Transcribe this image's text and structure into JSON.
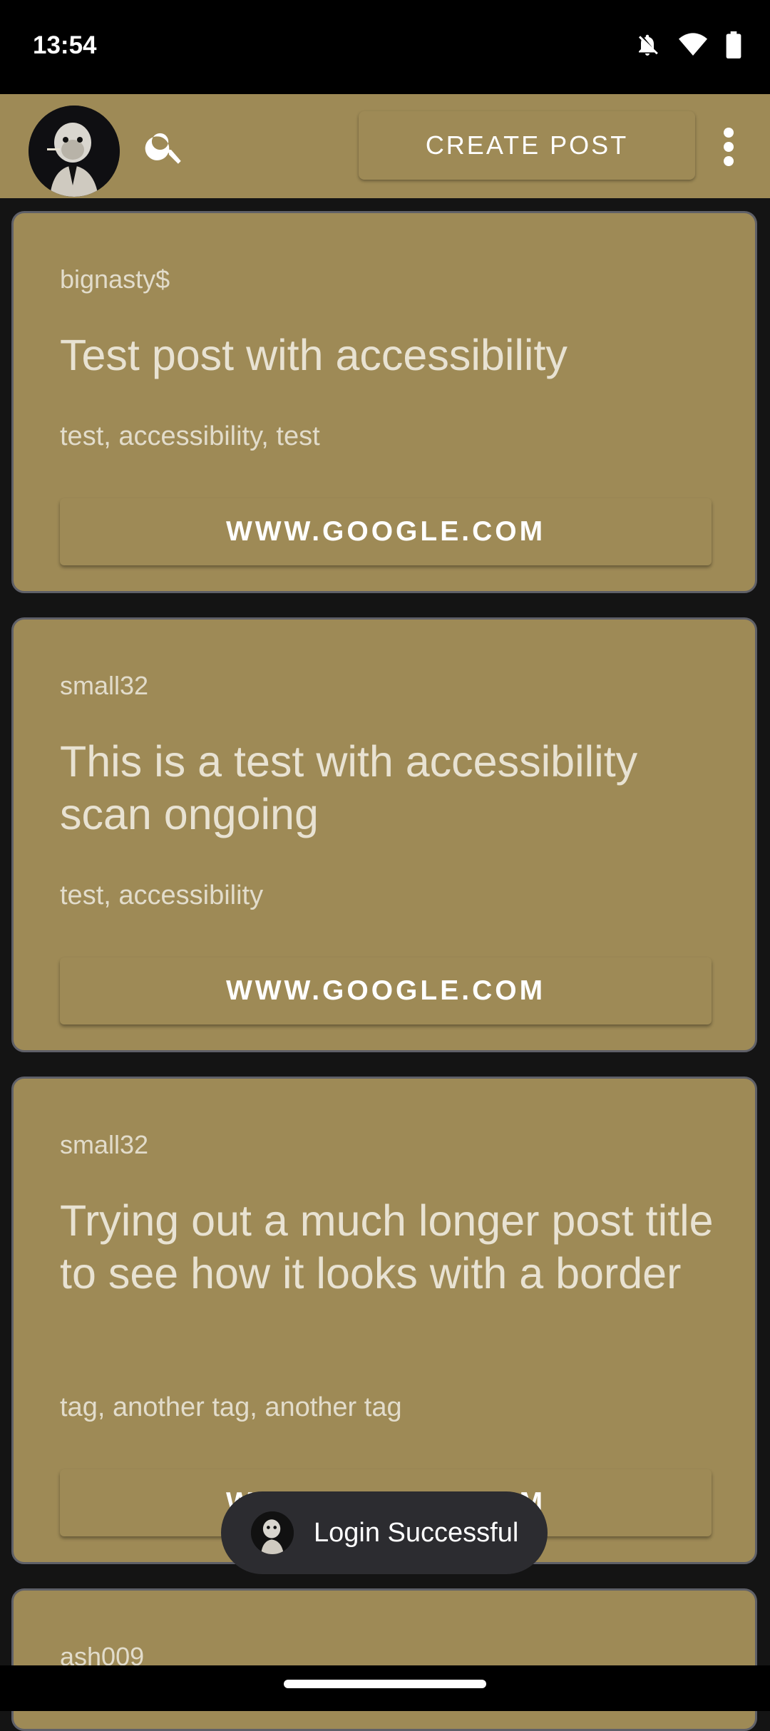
{
  "status_bar": {
    "time": "13:54",
    "icons": [
      "bell-off-icon",
      "wifi-icon",
      "battery-icon"
    ]
  },
  "app_bar": {
    "avatar_icon": "monkey-avatar",
    "search_icon": "search-icon",
    "create_post_label": "CREATE POST",
    "more_icon": "more-vert-icon",
    "color": "#9e8a56"
  },
  "posts": [
    {
      "user": "bignasty$",
      "title": "Test post with accessibility",
      "tags": "test, accessibility, test",
      "link": "WWW.GOOGLE.COM"
    },
    {
      "user": "small32",
      "title": "This is a test with accessibility scan ongoing",
      "tags": "test, accessibility",
      "link": "WWW.GOOGLE.COM"
    },
    {
      "user": "small32",
      "title": "Trying out a much longer post title to see how it looks with a border",
      "tags": "tag, another tag, another tag",
      "link": "WWW.GOOGLE.COM"
    },
    {
      "user": "ash009"
    }
  ],
  "toast": {
    "message": "Login Successful"
  }
}
